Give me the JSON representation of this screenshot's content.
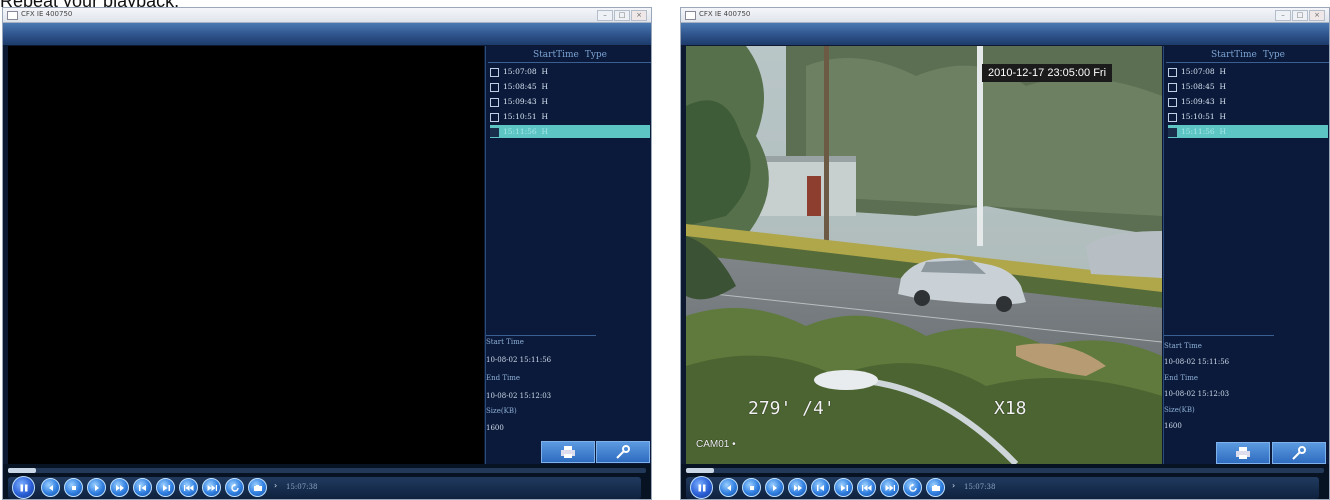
{
  "caption": "Repeat your playback.",
  "windows": [
    {
      "title": "CFX  IE  400750",
      "list_header": {
        "start_time": "StartTime",
        "type": "Type"
      },
      "records": [
        {
          "time": "15:07:08",
          "type": "H",
          "selected": false
        },
        {
          "time": "15:08:45",
          "type": "H",
          "selected": false
        },
        {
          "time": "15:09:43",
          "type": "H",
          "selected": false
        },
        {
          "time": "15:10:51",
          "type": "H",
          "selected": false
        },
        {
          "time": "15:11:56",
          "type": "H",
          "selected": true
        }
      ],
      "info": {
        "start_label": "Start Time",
        "start_value": "10-08-02 15:11:56",
        "end_label": "End Time",
        "end_value": "10-08-02 15:12:03",
        "size_label": "Size(KB)",
        "size_value": "1600"
      },
      "time_readout": "15:07:38",
      "video_playing": false
    },
    {
      "title": "CFX  IE  400750",
      "list_header": {
        "start_time": "StartTime",
        "type": "Type"
      },
      "records": [
        {
          "time": "15:07:08",
          "type": "H",
          "selected": false
        },
        {
          "time": "15:08:45",
          "type": "H",
          "selected": false
        },
        {
          "time": "15:09:43",
          "type": "H",
          "selected": false
        },
        {
          "time": "15:10:51",
          "type": "H",
          "selected": false
        },
        {
          "time": "15:11:56",
          "type": "H",
          "selected": true
        }
      ],
      "info": {
        "start_label": "Start Time",
        "start_value": "10-08-02 15:11:56",
        "end_label": "End Time",
        "end_value": "10-08-02 15:12:03",
        "size_label": "Size(KB)",
        "size_value": "1600"
      },
      "time_readout": "15:07:38",
      "video_playing": true,
      "osd": {
        "datetime": "2010-12-17 23:05:00 Fri",
        "pan_tilt": "279' /4'",
        "zoom": "X18",
        "camera": "CAM01"
      }
    }
  ],
  "controls": [
    "pause-icon",
    "prev-icon",
    "stop-icon",
    "play-icon",
    "fast-forward-icon",
    "previous-frame-icon",
    "next-frame-icon",
    "rewind-icon",
    "skip-forward-icon",
    "repeat-icon",
    "snapshot-icon"
  ],
  "colors": {
    "selected_row": "#5ec5c5",
    "panel_bg": "#0b1a3a",
    "button_blue": "#2f7ee0",
    "title_strip": "#2c5088"
  }
}
